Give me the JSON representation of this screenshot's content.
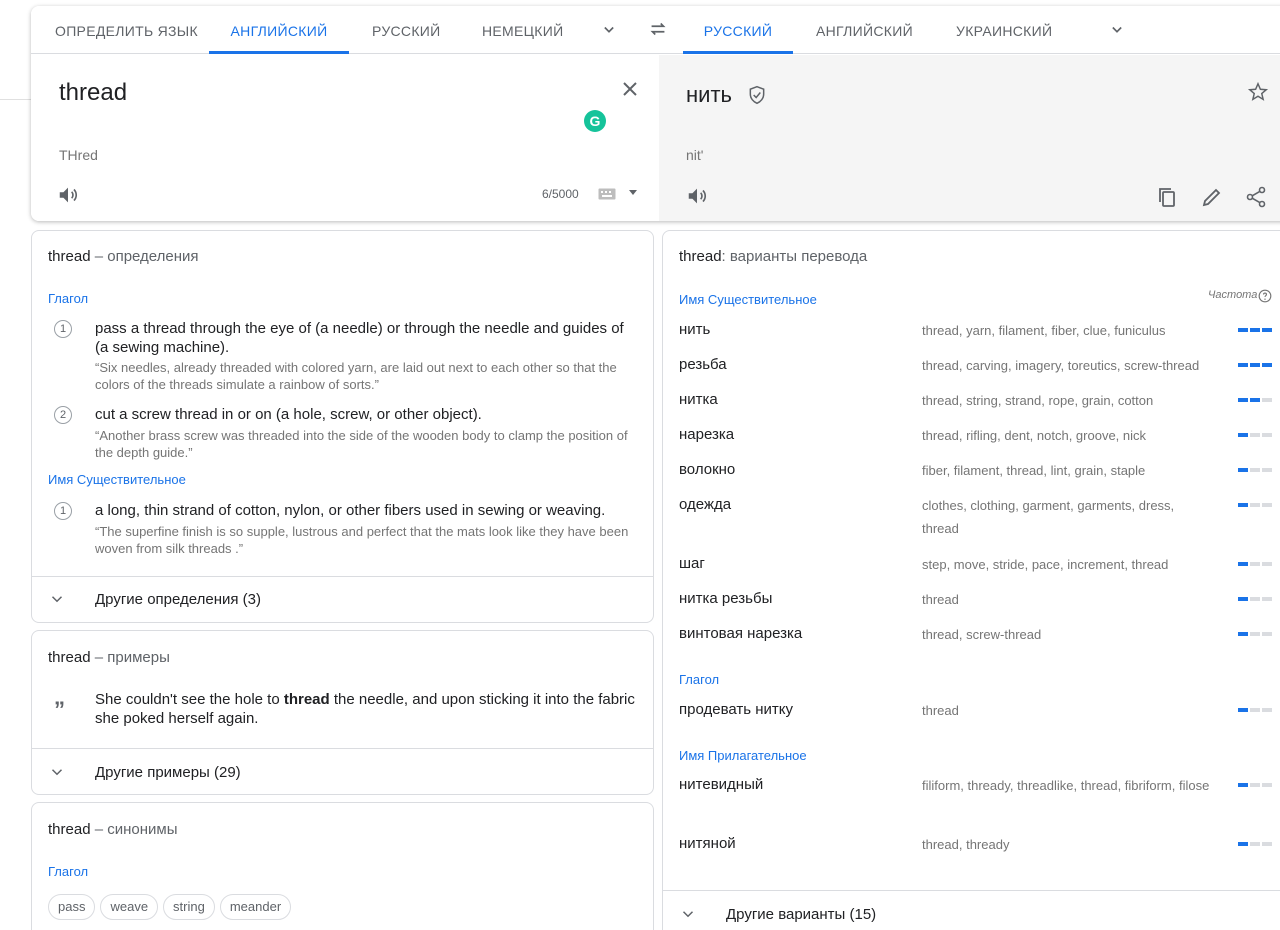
{
  "source_langs": {
    "detect": "Определить язык",
    "english": "Английский",
    "russian": "Русский",
    "german": "Немецкий"
  },
  "target_langs": {
    "russian": "Русский",
    "english": "Английский",
    "ukrainian": "Украинский"
  },
  "source": {
    "text": "thread",
    "transliteration": "THred",
    "counter": "6/5000",
    "grammarly": "G"
  },
  "target": {
    "text": "нить",
    "transliteration": "nit'"
  },
  "definitions": {
    "title_word": "thread",
    "title_rest": " – определения",
    "pos_verb": "Глагол",
    "verb": [
      {
        "num": "1",
        "text": "pass a thread through the eye of (a needle) or through the needle and guides of (a sewing machine).",
        "example": "“Six needles, already threaded with colored yarn, are laid out next to each other so that the colors of the threads simulate a rainbow of sorts.”"
      },
      {
        "num": "2",
        "text": "cut a screw thread in or on (a hole, screw, or other object).",
        "example": "“Another brass screw was threaded into the side of the wooden body to clamp the position of the depth guide.”"
      }
    ],
    "pos_noun": "Имя Существительное",
    "noun": [
      {
        "num": "1",
        "text": "a long, thin strand of cotton, nylon, or other fibers used in sewing or weaving.",
        "example": "“The superfine finish is so supple, lustrous and perfect that the mats look like they have been woven from silk threads .”"
      }
    ],
    "more": "Другие определения (3)"
  },
  "examples": {
    "title_word": "thread",
    "title_rest": " – примеры",
    "before": "She couldn't see the hole to ",
    "bold": "thread",
    "after": " the needle, and upon sticking it into the fabric she poked herself again.",
    "more": "Другие примеры (29)"
  },
  "synonyms": {
    "title_word": "thread",
    "title_rest": " – синонимы",
    "pos": "Глагол",
    "chips": [
      "pass",
      "weave",
      "string",
      "meander"
    ]
  },
  "variants": {
    "title_word": "thread",
    "title_rest": ": варианты перевода",
    "frequency_label": "Частота",
    "groups": [
      {
        "pos": "Имя Существительное",
        "rows": [
          {
            "word": "нить",
            "syn": "thread, yarn, filament, fiber, clue, funiculus",
            "freq": 3
          },
          {
            "word": "резьба",
            "syn": "thread, carving, imagery, toreutics, screw-thread",
            "freq": 3
          },
          {
            "word": "нитка",
            "syn": "thread, string, strand, rope, grain, cotton",
            "freq": 2
          },
          {
            "word": "нарезка",
            "syn": "thread, rifling, dent, notch, groove, nick",
            "freq": 1
          },
          {
            "word": "волокно",
            "syn": "fiber, filament, thread, lint, grain, staple",
            "freq": 1
          },
          {
            "word": "одежда",
            "syn": "clothes, clothing, garment, garments, dress, thread",
            "freq": 1
          },
          {
            "word": "шаг",
            "syn": "step, move, stride, pace, increment, thread",
            "freq": 1
          },
          {
            "word": "нитка резьбы",
            "syn": "thread",
            "freq": 1
          },
          {
            "word": "винтовая нарезка",
            "syn": "thread, screw-thread",
            "freq": 1
          }
        ]
      },
      {
        "pos": "Глагол",
        "rows": [
          {
            "word": "продевать нитку",
            "syn": "thread",
            "freq": 1
          }
        ]
      },
      {
        "pos": "Имя Прилагательное",
        "rows": [
          {
            "word": "нитевидный",
            "syn": "filiform, thready, threadlike, thread, fibriform, filose",
            "freq": 1
          },
          {
            "word": "нитяной",
            "syn": "thread, thready",
            "freq": 1
          }
        ]
      }
    ],
    "more": "Другие варианты (15)"
  },
  "colors": {
    "accent": "#1a73e8",
    "grammarly": "#15c39a"
  }
}
